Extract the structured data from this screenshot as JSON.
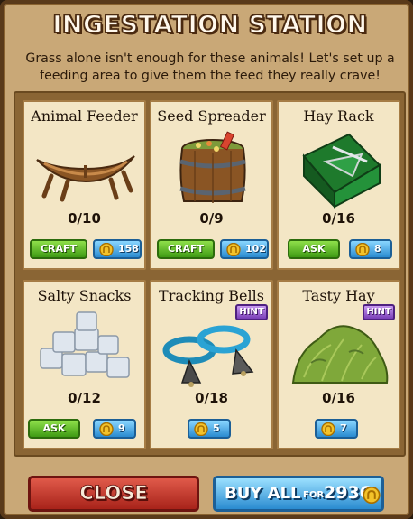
{
  "dialog": {
    "title": "INGESTATION STATION",
    "intro": "Grass alone isn't enough for these animals! Let's set up a feeding area to give them the feed they really crave!"
  },
  "items": [
    {
      "name": "Animal Feeder",
      "count": "0/10",
      "action": "CRAFT",
      "price": "158",
      "icon": "canoe-feeder-icon",
      "hint": ""
    },
    {
      "name": "Seed Spreader",
      "count": "0/9",
      "action": "CRAFT",
      "price": "102",
      "icon": "seed-barrel-icon",
      "hint": ""
    },
    {
      "name": "Hay Rack",
      "count": "0/16",
      "action": "ASK",
      "price": "8",
      "icon": "hay-rack-icon",
      "hint": ""
    },
    {
      "name": "Salty Snacks",
      "count": "0/12",
      "action": "ASK",
      "price": "9",
      "icon": "salt-blocks-icon",
      "hint": ""
    },
    {
      "name": "Tracking Bells",
      "count": "0/18",
      "action": "",
      "price": "5",
      "icon": "bells-icon",
      "hint": "HINT"
    },
    {
      "name": "Tasty Hay",
      "count": "0/16",
      "action": "",
      "price": "7",
      "icon": "hay-pile-icon",
      "hint": "HINT"
    }
  ],
  "footer": {
    "close_label": "CLOSE",
    "buy_all_label": "BUY ALL",
    "buy_all_for": "FOR",
    "buy_all_price": "2936"
  },
  "colors": {
    "craft_green": "#3f9a14",
    "coin_blue": "#2a8bd0",
    "hint_purple": "#7a3fb8",
    "close_red": "#a8231a"
  }
}
